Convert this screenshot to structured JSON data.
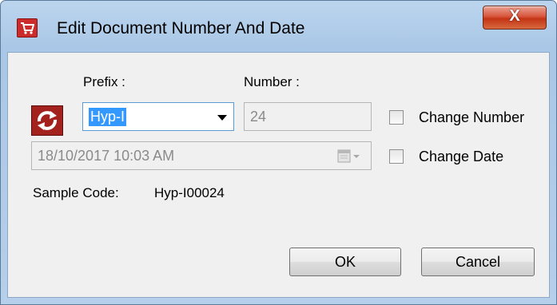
{
  "window": {
    "title": "Edit Document Number And Date",
    "close_label": "X"
  },
  "form": {
    "prefix_label": "Prefix :",
    "number_label": "Number :",
    "prefix_value": "Hyp-I",
    "number_value": "24",
    "date_value": "18/10/2017 10:03 AM",
    "change_number_label": "Change Number",
    "change_date_label": "Change Date",
    "change_number_checked": false,
    "change_date_checked": false,
    "sample_code_label": "Sample Code:",
    "sample_code_value": "Hyp-I00024"
  },
  "buttons": {
    "ok_label": "OK",
    "cancel_label": "Cancel"
  },
  "icons": {
    "app": "cart-icon",
    "refresh": "refresh-icon",
    "calendar": "calendar-icon"
  },
  "colors": {
    "accent_red": "#a3221d",
    "selection_blue": "#3399ff",
    "close_red": "#c33416"
  }
}
